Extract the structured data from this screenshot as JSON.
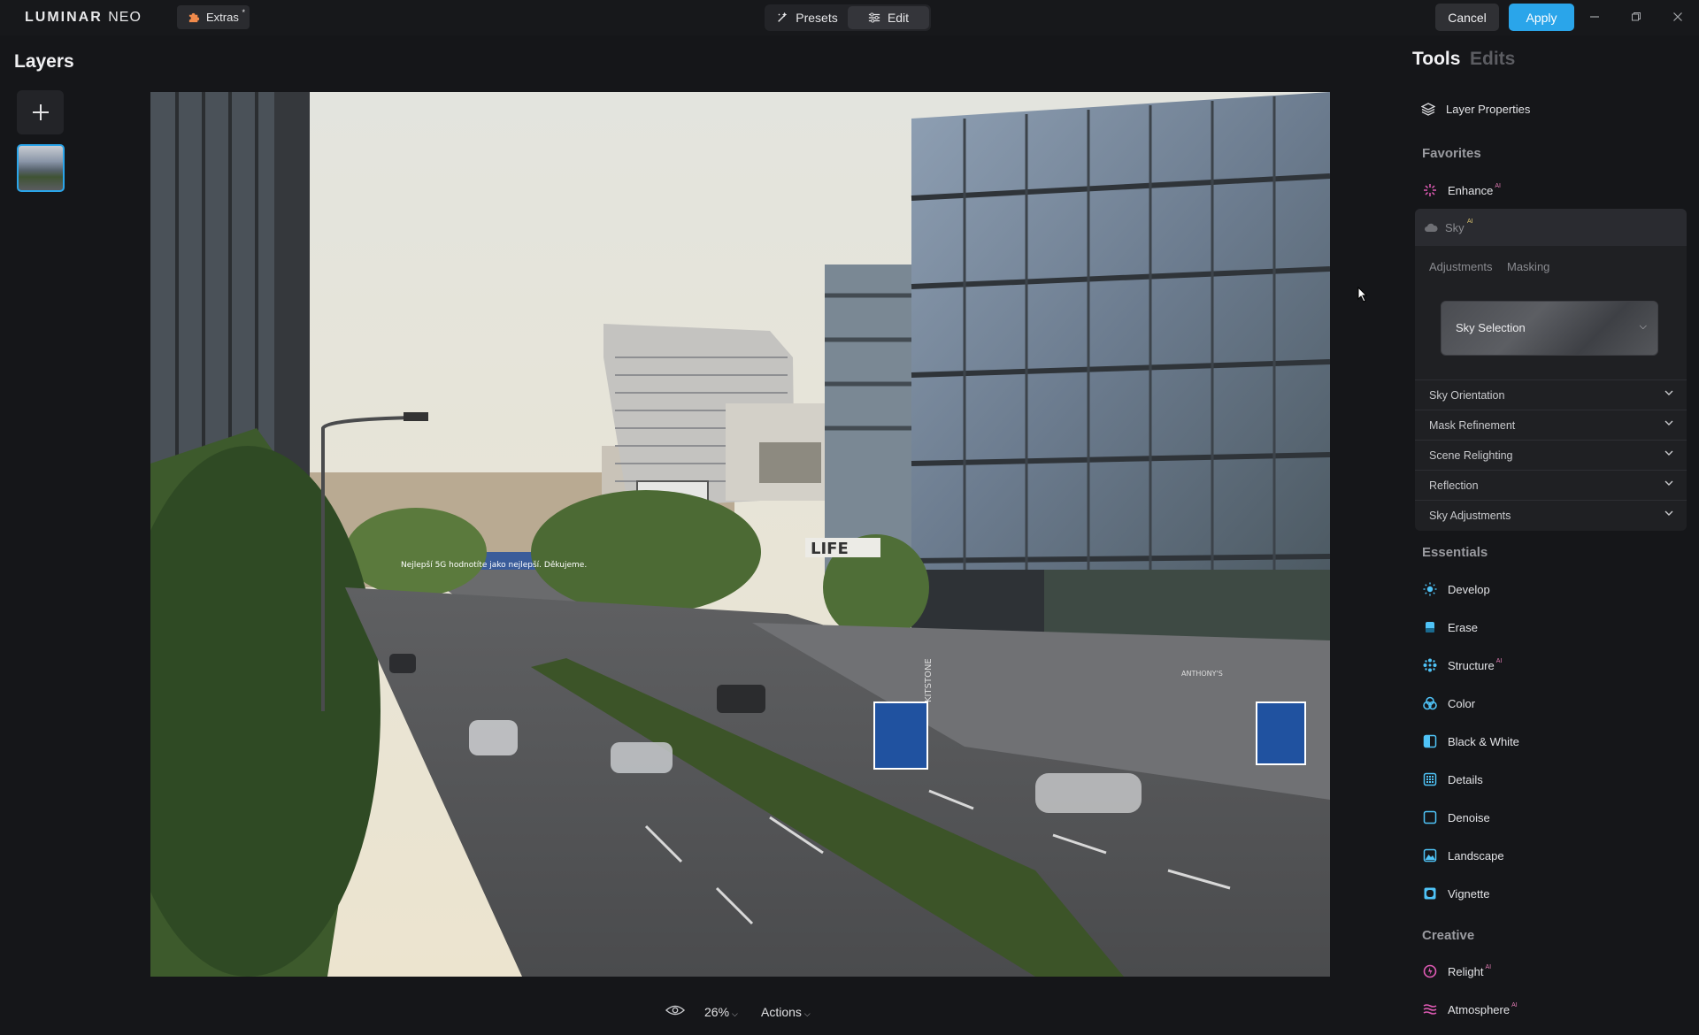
{
  "app": {
    "logo_main": "LUMINAR",
    "logo_sub": "NEO"
  },
  "topbar": {
    "extras_label": "Extras",
    "extras_dot": "*",
    "tabs": [
      {
        "label": "Presets",
        "icon": "presets-icon",
        "active": false
      },
      {
        "label": "Edit",
        "icon": "sliders-icon",
        "active": true
      }
    ],
    "cancel_label": "Cancel",
    "apply_label": "Apply",
    "window_controls": [
      "minimize-icon",
      "restore-icon",
      "close-icon"
    ]
  },
  "layers": {
    "title": "Layers",
    "add_icon": "plus-icon"
  },
  "canvas": {
    "zoom": "26%",
    "actions_label": "Actions",
    "billboard_text": "Nejlepší 5G hodnotíte jako nejlepší. Děkujeme.",
    "sign_text": "LIFE",
    "building_text": "KITSTONE",
    "store_text": "ANTHONY'S"
  },
  "panel": {
    "tab_tools": "Tools",
    "tab_edits": "Edits",
    "layer_properties": "Layer Properties",
    "favorites_label": "Favorites",
    "enhance": {
      "label": "Enhance",
      "ai": "AI"
    },
    "sky": {
      "label": "Sky",
      "ai": "AI",
      "subtabs": [
        "Adjustments",
        "Masking"
      ],
      "selection_label": "Sky Selection",
      "accordions": [
        "Sky Orientation",
        "Mask Refinement",
        "Scene Relighting",
        "Reflection",
        "Sky Adjustments"
      ]
    },
    "essentials_label": "Essentials",
    "essentials": [
      {
        "label": "Develop",
        "ai": "",
        "icon": "sun-icon",
        "color": "#4fc3f7"
      },
      {
        "label": "Erase",
        "ai": "",
        "icon": "eraser-icon",
        "color": "#4fc3f7"
      },
      {
        "label": "Structure",
        "ai": "AI",
        "icon": "structure-icon",
        "color": "#4fc3f7"
      },
      {
        "label": "Color",
        "ai": "",
        "icon": "color-icon",
        "color": "#4fc3f7"
      },
      {
        "label": "Black & White",
        "ai": "",
        "icon": "bw-icon",
        "color": "#4fc3f7"
      },
      {
        "label": "Details",
        "ai": "",
        "icon": "details-icon",
        "color": "#4fc3f7"
      },
      {
        "label": "Denoise",
        "ai": "",
        "icon": "denoise-icon",
        "color": "#4fc3f7"
      },
      {
        "label": "Landscape",
        "ai": "",
        "icon": "landscape-icon",
        "color": "#4fc3f7"
      },
      {
        "label": "Vignette",
        "ai": "",
        "icon": "vignette-icon",
        "color": "#4fc3f7"
      }
    ],
    "creative_label": "Creative",
    "creative": [
      {
        "label": "Relight",
        "ai": "AI",
        "icon": "relight-icon",
        "color": "#e05bb5"
      },
      {
        "label": "Atmosphere",
        "ai": "AI",
        "icon": "atmosphere-icon",
        "color": "#e05bb5"
      }
    ]
  },
  "colors": {
    "accent": "#2aa5ea",
    "essentials_icon": "#4fc3f7",
    "creative_icon": "#e05bb5",
    "enhance_icon": "#e05bb5"
  }
}
